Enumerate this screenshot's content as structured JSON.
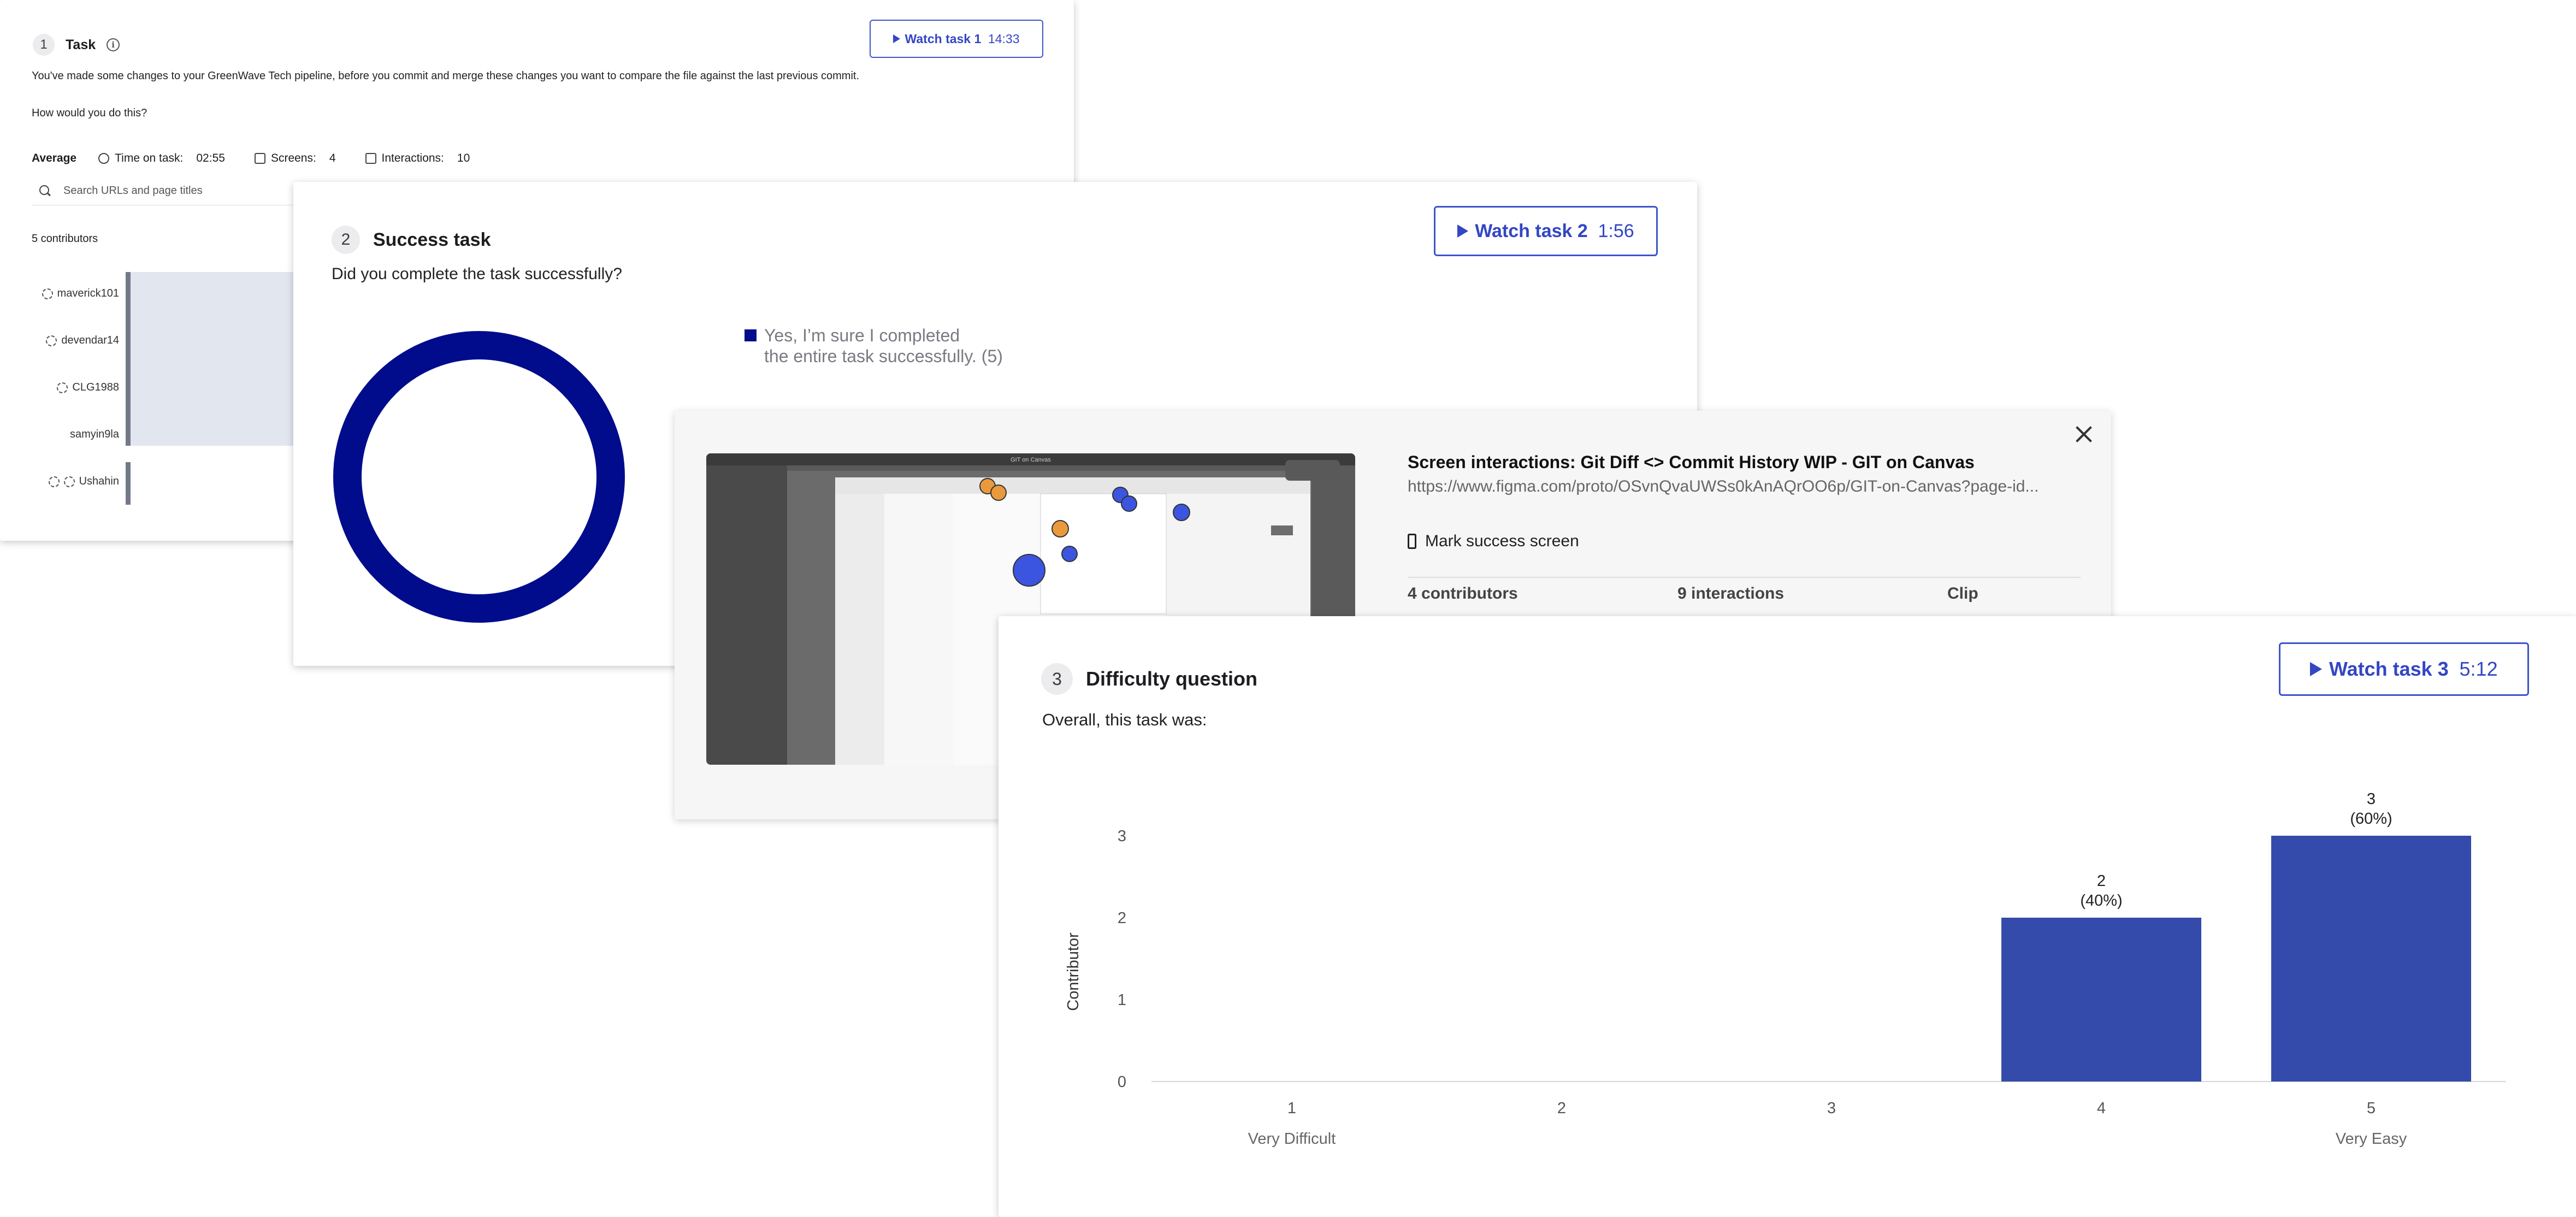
{
  "card1": {
    "number": "1",
    "title": "Task",
    "description_line1": "You've made some changes to your GreenWave Tech pipeline, before you commit and merge these changes you want to compare the file against the last previous commit.",
    "description_line2": "How would you do this?",
    "watch": {
      "label": "Watch task 1",
      "duration": "14:33"
    },
    "average_label": "Average",
    "stats": [
      {
        "label": "Time on task:",
        "value": "02:55",
        "icon": "timer-icon"
      },
      {
        "label": "Screens:",
        "value": "4",
        "icon": "screens-icon"
      },
      {
        "label": "Interactions:",
        "value": "10",
        "icon": "interactions-icon"
      }
    ],
    "search_placeholder": "Search URLs and page titles",
    "contributors_label": "5 contributors",
    "users": [
      "maverick101",
      "devendar14",
      "CLG1988",
      "samyin9la",
      "Ushahin"
    ]
  },
  "card2": {
    "number": "2",
    "title": "Success task",
    "question": "Did you complete the task successfully?",
    "watch": {
      "label": "Watch task 2",
      "duration": "1:56"
    },
    "legend_line1": "Yes, I’m sure I completed",
    "legend_line2": "the entire task successfully. (5)",
    "donut": {
      "color": "#000c8c",
      "yes_count": 5,
      "total": 5
    }
  },
  "card3": {
    "title": "Screen interactions: Git Diff <> Commit History WIP - GIT on Canvas",
    "url": "https://www.figma.com/proto/OSvnQvaUWSs0kAnAQrOO6p/GIT-on-Canvas?page-id...",
    "mark_label": "Mark success screen",
    "contributors": "4 contributors",
    "interactions": "9 interactions",
    "clip": "Clip",
    "thumb_title": "GIT on Canvas"
  },
  "card4": {
    "number": "3",
    "title": "Difficulty question",
    "question": "Overall, this task was:",
    "watch": {
      "label": "Watch task 3",
      "duration": "5:12"
    }
  },
  "chart_data": {
    "type": "bar",
    "categories": [
      "1",
      "2",
      "3",
      "4",
      "5"
    ],
    "category_sublabels": [
      "Very Difficult",
      "",
      "",
      "",
      "Very Easy"
    ],
    "values": [
      0,
      0,
      0,
      2,
      3
    ],
    "percent_labels": [
      "",
      "",
      "",
      "(40%)",
      "(60%)"
    ],
    "ylabel": "Contributor",
    "yticks": [
      0,
      1,
      2,
      3
    ],
    "ylim": [
      0,
      3
    ],
    "bar_color": "#344bab",
    "grid": false
  }
}
